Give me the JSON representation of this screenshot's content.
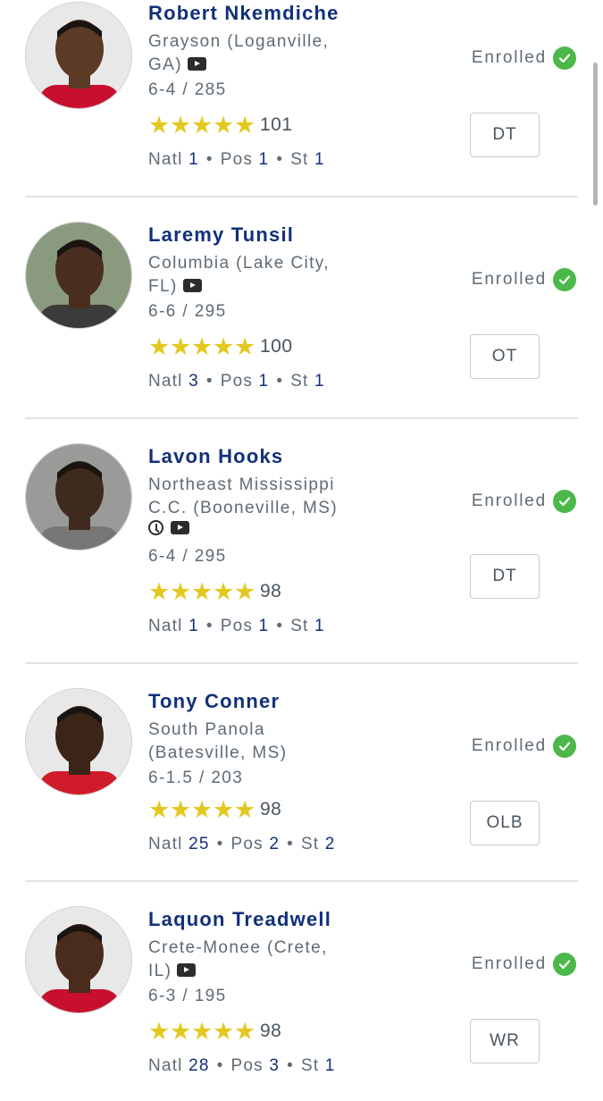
{
  "players": [
    {
      "name": "Robert Nkemdiche",
      "school_line1": "Grayson (Loganville,",
      "school_line2": "GA)",
      "has_video": true,
      "has_clock": false,
      "ht_wt": "6-4 / 285",
      "rating": "101",
      "natl": "1",
      "pos_rank": "1",
      "st": "1",
      "position": "DT",
      "status": "Enrolled",
      "skin": "#5b3a26",
      "shirt": "#c8102e"
    },
    {
      "name": "Laremy Tunsil",
      "school_line1": "Columbia (Lake City,",
      "school_line2": "FL)",
      "has_video": true,
      "has_clock": false,
      "ht_wt": "6-6 / 295",
      "rating": "100",
      "natl": "3",
      "pos_rank": "1",
      "st": "1",
      "position": "OT",
      "status": "Enrolled",
      "skin": "#4a2e20",
      "shirt": "#3b3b3b"
    },
    {
      "name": "Lavon Hooks",
      "school_line1": "Northeast Mississippi",
      "school_line2": "C.C. (Booneville, MS)",
      "has_video": true,
      "has_clock": true,
      "ht_wt": "6-4 / 295",
      "rating": "98",
      "natl": "1",
      "pos_rank": "1",
      "st": "1",
      "position": "DT",
      "status": "Enrolled",
      "skin": "#3e2a1e",
      "shirt": "#777777"
    },
    {
      "name": "Tony Conner",
      "school_line1": "South Panola",
      "school_line2": "(Batesville, MS)",
      "has_video": false,
      "has_clock": false,
      "ht_wt": "6-1.5 / 203",
      "rating": "98",
      "natl": "25",
      "pos_rank": "2",
      "st": "2",
      "position": "OLB",
      "status": "Enrolled",
      "skin": "#3b2418",
      "shirt": "#d01b2a"
    },
    {
      "name": "Laquon Treadwell",
      "school_line1": "Crete-Monee (Crete,",
      "school_line2": "IL)",
      "has_video": true,
      "has_clock": false,
      "ht_wt": "6-3 / 195",
      "rating": "98",
      "natl": "28",
      "pos_rank": "3",
      "st": "1",
      "position": "WR",
      "status": "Enrolled",
      "skin": "#4a2c1c",
      "shirt": "#c8102e"
    }
  ],
  "labels": {
    "natl": "Natl",
    "pos": "Pos",
    "st": "St"
  },
  "icons": {
    "video": "video-icon",
    "clock": "clock-icon",
    "check": "check-circle-icon",
    "star": "star-icon"
  },
  "colors": {
    "name": "#12307a",
    "star": "#e3c81f",
    "check": "#4cb84a"
  }
}
